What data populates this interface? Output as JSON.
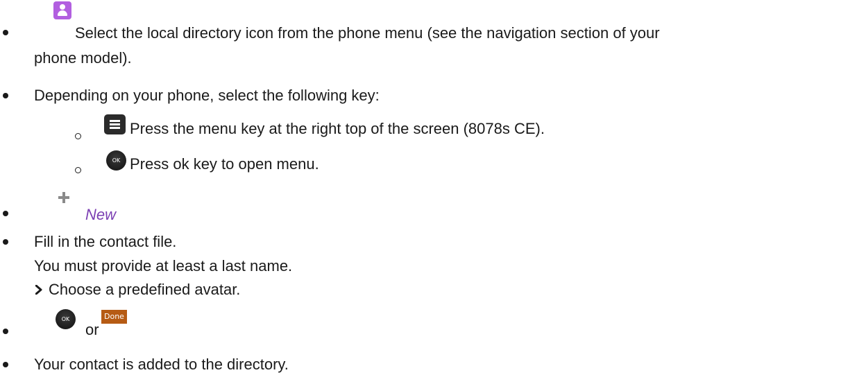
{
  "steps": [
    {
      "text_line1": "Select the local directory icon from the phone menu (see the navigation section of your",
      "text_line2": "phone model).",
      "icon": "directory-icon"
    },
    {
      "text": "Depending on your phone, select the following key:",
      "sub_steps": [
        {
          "icon": "menu-key-icon",
          "text": "Press the menu key at the right top of the screen (8078s CE)."
        },
        {
          "icon": "ok-key-icon",
          "icon_label": "OK",
          "text": "Press ok key to open menu."
        }
      ]
    },
    {
      "icon": "plus-icon",
      "text": "New"
    },
    {
      "text_line1": "Fill in the contact file.",
      "text_line2": "You must provide at least a last name.",
      "extra_icon": "chevron-right-icon",
      "extra_text": "Choose a predefined avatar."
    },
    {
      "icon": "ok-key-icon",
      "icon_label": "OK",
      "connector": "or",
      "button_label": "Done"
    },
    {
      "text": "Your contact is added to the directory."
    }
  ],
  "colors": {
    "text": "#1a1a1a",
    "accent_purple": "#7b3fb3",
    "directory_icon": "#b25fe0",
    "done_button": "#b65b14"
  }
}
